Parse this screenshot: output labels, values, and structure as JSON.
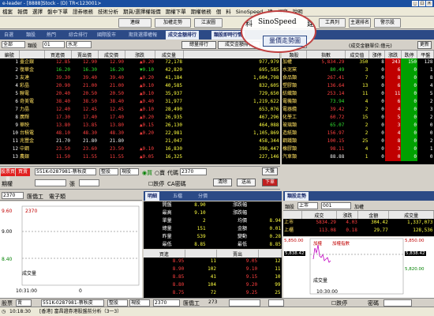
{
  "window": {
    "title": "e-leader - [8888]Stock - (D)  TR<123001>",
    "buttons": [
      "_",
      "□",
      "×"
    ]
  },
  "menu": [
    "檔案",
    "報價",
    "選擇",
    "盤中下單",
    "證券帳務",
    "技術分析",
    "期貨/選擇權報價",
    "期權下單",
    "期權帳務",
    "個",
    "料",
    "SinoSpeed",
    "建",
    "視窗",
    "說明"
  ],
  "toolbar": {
    "buttons": [
      "連線",
      "加權走勢",
      "江波圖",
      "工具列",
      "主選排名",
      "警示股"
    ]
  },
  "magnifier": {
    "top_text": [
      "料",
      "SinoSpeed",
      "建"
    ],
    "tab_label": "量價走勢圖"
  },
  "top_tabs": [
    "自選",
    "類股",
    "熱門",
    "綜合排行",
    "國際股市",
    "期貨選擇權報",
    "成交金額排行",
    "類股即時行情"
  ],
  "left_panel": {
    "controls": {
      "market": "全部",
      "category_label": "類股",
      "category": "01",
      "cat_name": "水泥",
      "rank_button": "總量排行",
      "amount_button": "成交金額排行"
    },
    "headers": [
      "編號",
      "",
      "買進價",
      "賣出價",
      "成交價",
      "漲跌",
      "成交量"
    ],
    "rows": [
      {
        "no": "1",
        "name": "臺企銀",
        "bid": "12.85",
        "ask": "12.90",
        "last": "12.90",
        "chg": "0.20",
        "vol": "72,178",
        "amt": "977,979",
        "dir": "up"
      },
      {
        "no": "2",
        "name": "復華金",
        "bid": "16.20",
        "ask": "16.30",
        "last": "16.20",
        "chg": "0.10",
        "vol": "42,820",
        "amt": "695,585",
        "dir": "dn"
      },
      {
        "no": "3",
        "name": "友達",
        "bid": "39.30",
        "ask": "39.40",
        "last": "39.40",
        "chg": "0.20",
        "vol": "41,184",
        "amt": "1,604,798",
        "dir": "up"
      },
      {
        "no": "4",
        "name": "彩晶",
        "bid": "20.90",
        "ask": "21.00",
        "last": "21.00",
        "chg": "0.10",
        "vol": "40,585",
        "amt": "832,605",
        "dir": "up"
      },
      {
        "no": "5",
        "name": "聯電",
        "bid": "20.40",
        "ask": "20.50",
        "last": "20.50",
        "chg": "0.10",
        "vol": "35,937",
        "amt": "729,650",
        "dir": "up"
      },
      {
        "no": "6",
        "name": "奇美電",
        "bid": "38.40",
        "ask": "38.50",
        "last": "38.40",
        "chg": "0.40",
        "vol": "31,977",
        "amt": "1,219,622",
        "dir": "up"
      },
      {
        "no": "7",
        "name": "力晶",
        "bid": "12.40",
        "ask": "12.45",
        "last": "12.45",
        "chg": "0.10",
        "vol": "28,490",
        "amt": "653,076",
        "dir": "up"
      },
      {
        "no": "8",
        "name": "廣輝",
        "bid": "17.30",
        "ask": "17.40",
        "last": "17.40",
        "chg": "0.20",
        "vol": "26,935",
        "amt": "467,296",
        "dir": "up"
      },
      {
        "no": "9",
        "name": "華映",
        "bid": "13.80",
        "ask": "13.85",
        "last": "13.80",
        "chg": "0.15",
        "vol": "26,130",
        "amt": "464,088",
        "dir": "up"
      },
      {
        "no": "10",
        "name": "台積電",
        "bid": "48.10",
        "ask": "48.30",
        "last": "48.30",
        "chg": "0.20",
        "vol": "22,981",
        "amt": "1,105,869",
        "dir": "up"
      },
      {
        "no": "11",
        "name": "兆豐金",
        "bid": "21.70",
        "ask": "21.80",
        "last": "21.80",
        "chg": "",
        "vol": "21,047",
        "amt": "458,344",
        "dir": "fl"
      },
      {
        "no": "12",
        "name": "中鋼",
        "bid": "23.50",
        "ask": "23.60",
        "last": "23.50",
        "chg": "0.10",
        "vol": "16,830",
        "amt": "398,447",
        "dir": "up"
      },
      {
        "no": "13",
        "name": "農銀",
        "bid": "11.50",
        "ask": "11.55",
        "last": "11.55",
        "chg": "0.05",
        "vol": "16,325",
        "amt": "227,146",
        "dir": "up"
      }
    ]
  },
  "right_panel": {
    "controls": {
      "market": "全部",
      "amount_label": "(成交金額單位:億元)",
      "update_button": "更新"
    },
    "headers": [
      "類股",
      "指數",
      "成交值",
      "漲停",
      "漲跌",
      "跌停",
      "平盤"
    ],
    "rows": [
      {
        "name": "加權",
        "idx": "5,834.29",
        "val": "350",
        "up": "8",
        "chg": "243",
        "dn": "150",
        "flat": "128",
        "dir": "up"
      },
      {
        "name": "水泥窯",
        "idx": "80.49",
        "val": "3",
        "up": "0",
        "chg": "6",
        "dn": "0",
        "flat": "1",
        "dir": "dn"
      },
      {
        "name": "食品類",
        "idx": "267.41",
        "val": "7",
        "up": "0",
        "chg": "8",
        "dn": "0",
        "flat": "8",
        "dir": "up"
      },
      {
        "name": "塑膠類",
        "idx": "136.64",
        "val": "13",
        "up": "0",
        "chg": "6",
        "dn": "0",
        "flat": "4",
        "dir": "up"
      },
      {
        "name": "紡織類",
        "idx": "253.14",
        "val": "11",
        "up": "0",
        "chg": "11",
        "dn": "0",
        "flat": "5",
        "dir": "up"
      },
      {
        "name": "電機類",
        "idx": "73.94",
        "val": "4",
        "up": "0",
        "chg": "6",
        "dn": "0",
        "flat": "2",
        "dir": "dn"
      },
      {
        "name": "電器纜",
        "idx": "39.42",
        "val": "2",
        "up": "0",
        "chg": "4",
        "dn": "0",
        "flat": "3",
        "dir": "up"
      },
      {
        "name": "化學工",
        "idx": "60.72",
        "val": "15",
        "up": "0",
        "chg": "5",
        "dn": "0",
        "flat": "2",
        "dir": "up"
      },
      {
        "name": "玻璃類",
        "idx": "65.07",
        "val": "2",
        "up": "0",
        "chg": "3",
        "dn": "0",
        "flat": "0",
        "dir": "dn"
      },
      {
        "name": "造紙類",
        "idx": "156.97",
        "val": "2",
        "up": "0",
        "chg": "4",
        "dn": "0",
        "flat": "0",
        "dir": "up"
      },
      {
        "name": "鋼鐵類",
        "idx": "100.15",
        "val": "25",
        "up": "0",
        "chg": "8",
        "dn": "0",
        "flat": "2",
        "dir": "up"
      },
      {
        "name": "橡膠類",
        "idx": "98.11",
        "val": "4",
        "up": "0",
        "chg": "3",
        "dn": "0",
        "flat": "1",
        "dir": "up"
      },
      {
        "name": "汽車類",
        "idx": "88.88",
        "val": "1",
        "up": "0",
        "chg": "0",
        "dn": "0",
        "flat": "0",
        "dir": "fl"
      }
    ]
  },
  "order_bar": {
    "buy_tab": "股票買賣",
    "sell_tab": "買賣",
    "account": "551K-0287981-蔡秋皮",
    "order_type": "整股",
    "price_type": "現股",
    "side_buy": "買",
    "side_sell": "賣",
    "code_label": "代碼",
    "code": "2370",
    "price_label": "價格",
    "qty_label": "數量",
    "unit": "張",
    "row2_labels": [
      "期權",
      "買權",
      "單價",
      "單價"
    ],
    "buttons": [
      "大盤",
      "下單"
    ],
    "check_label": "跌停",
    "check2": "CA密碼",
    "clear_btn": "清除",
    "sub_btn": "送出"
  },
  "stock_chart": {
    "code": "2370",
    "name": "匯僑工",
    "category": "電子類",
    "prices": [
      "9.60",
      "9.00",
      "8.40"
    ],
    "code_small": "2370",
    "vol_label": "成交量",
    "time": "10:31:00",
    "vol_value": "0",
    "chart_data": {
      "type": "line",
      "x": [],
      "values": [],
      "xlabel": "",
      "ylabel": ""
    }
  },
  "depth": {
    "tabs": [
      "明細",
      "五檔",
      "分價"
    ],
    "info": [
      {
        "l": "開盤",
        "v": "8.90",
        "l2": "漲跌幅",
        "v2": ""
      },
      {
        "l": "最高",
        "v": "9.10",
        "l2": "漲跌幅",
        "v2": ""
      },
      {
        "l": "單量",
        "v": "2",
        "l2": "均價",
        "v2": "8.94"
      },
      {
        "l": "總量",
        "v": "151",
        "l2": "金額",
        "v2": "0.01"
      },
      {
        "l": "昨量",
        "v": "539",
        "l2": "變動",
        "v2": "0.28"
      },
      {
        "l": "最低",
        "v": "8.85",
        "l2": "最低",
        "v2": "8.85"
      }
    ],
    "book_headers": [
      "買進",
      "",
      "賣出",
      ""
    ],
    "book": [
      {
        "bp": "8.95",
        "bq": "11",
        "ap": "9.05",
        "aq": "12"
      },
      {
        "bp": "8.90",
        "bq": "102",
        "ap": "9.10",
        "aq": "11"
      },
      {
        "bp": "8.85",
        "bq": "41",
        "ap": "9.15",
        "aq": "10"
      },
      {
        "bp": "8.80",
        "bq": "104",
        "ap": "9.20",
        "aq": "99"
      },
      {
        "bp": "8.75",
        "bq": "72",
        "ap": "9.25",
        "aq": "25"
      }
    ]
  },
  "trend": {
    "tab": "類股走勢",
    "category_label": "類股",
    "market": "上市",
    "code": "001",
    "index_name": "加權",
    "headers": [
      "",
      "成交",
      "漲跌",
      "金額",
      "成交量"
    ],
    "rows": [
      {
        "name": "上市",
        "price": "5834.29",
        "chg": "4.03",
        "amt": "304.42",
        "vol": "1,337,073"
      },
      {
        "name": "上櫃",
        "price": "113.08",
        "chg": "0.18",
        "amt": "29.77",
        "vol": "128,536"
      }
    ],
    "prices_left": [
      "5,850.00",
      "5,838.42"
    ],
    "prices_right": [
      "5,850.00",
      "5,838.42",
      "5,820.00"
    ],
    "legend": [
      "加權",
      "加權指數"
    ],
    "vol_label": "成交量",
    "time": "10:30:00",
    "x_value": "273",
    "chart_data": {
      "type": "line",
      "x": [],
      "values": [],
      "xlabel": "",
      "ylabel": ""
    }
  },
  "bottom_order": {
    "label": "股票",
    "side": "賣",
    "account": "551K-0287981-蔡秋皮",
    "order_type": "整股",
    "price_type": "現股",
    "code": "2370",
    "name": "匯僑工",
    "price_label": "",
    "check": "跌停",
    "pwd": "密碼"
  },
  "status": {
    "time": "10:18:30",
    "msg": "[香港] 富昌證券港股盤前分析（3一3）",
    "count": "273"
  },
  "colors": {
    "up": "#ff4040",
    "down": "#30e030",
    "accent": "#2c4a86"
  }
}
